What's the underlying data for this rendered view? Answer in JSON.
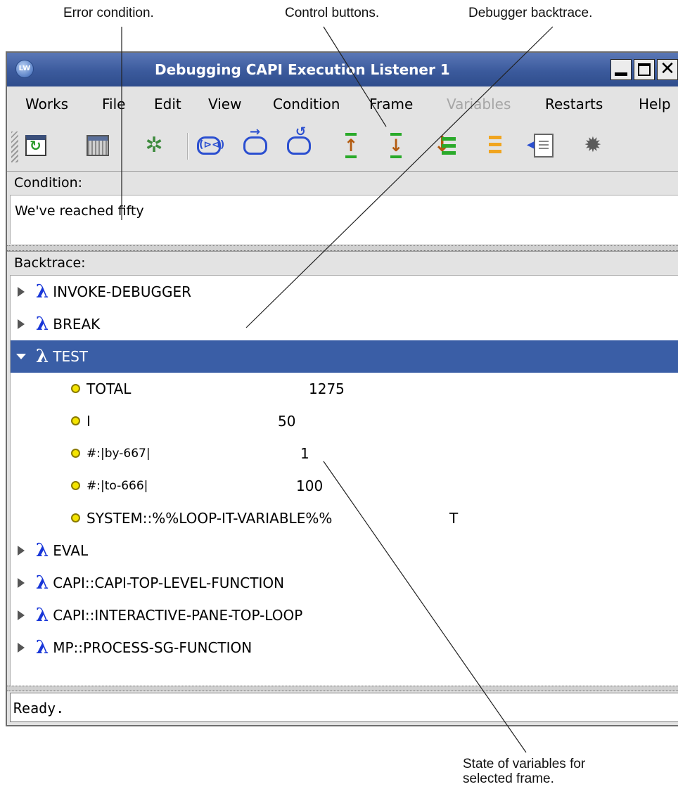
{
  "annotations": {
    "error_condition": "Error condition.",
    "control_buttons": "Control buttons.",
    "debugger_backtrace": "Debugger backtrace.",
    "variables_state_line1": "State of variables for",
    "variables_state_line2": "selected frame."
  },
  "window": {
    "icon_text": "LW",
    "title": "Debugging CAPI Execution Listener 1",
    "close_glyph": "✕"
  },
  "menu": {
    "items": [
      "Works",
      "File",
      "Edit",
      "View",
      "Condition",
      "Frame",
      "Variables",
      "Restarts",
      "Help"
    ],
    "disabled": [
      "Variables"
    ]
  },
  "toolbar": {
    "icons": [
      "refresh-window-icon",
      "window-list-icon",
      "preferences-icon",
      "abort-icon",
      "continue-icon",
      "restart-frame-icon",
      "step-out-icon",
      "step-into-icon",
      "list-frames-icon",
      "find-source-icon",
      "show-source-icon",
      "inspect-bug-icon"
    ],
    "abort_glyph": "(⊳⊲)",
    "step_out_glyph": "↑",
    "step_into_glyph": "↓",
    "list_glyph": "↓"
  },
  "condition": {
    "label": "Condition:",
    "text": "We've reached fifty"
  },
  "backtrace": {
    "label": "Backtrace:",
    "lambda_glyph": "λ",
    "frames_before": [
      "INVOKE-DEBUGGER",
      "BREAK"
    ],
    "selected_frame": "TEST",
    "variables": [
      {
        "name": "TOTAL",
        "value": "1275"
      },
      {
        "name": "I",
        "value": "50"
      },
      {
        "name": "#:|by-667|",
        "value": "1"
      },
      {
        "name": "#:|to-666|",
        "value": "100"
      },
      {
        "name": "SYSTEM::%%LOOP-IT-VARIABLE%%",
        "value": "T"
      }
    ],
    "frames_after": [
      "EVAL",
      "CAPI::CAPI-TOP-LEVEL-FUNCTION",
      "CAPI::INTERACTIVE-PANE-TOP-LOOP",
      "MP::PROCESS-SG-FUNCTION"
    ]
  },
  "status": {
    "text": "Ready."
  },
  "colors": {
    "title_bar": "#3b5a9c",
    "selection": "#3a5ea6",
    "lambda": "#1836d8",
    "variable_dot": "#f4e400"
  }
}
